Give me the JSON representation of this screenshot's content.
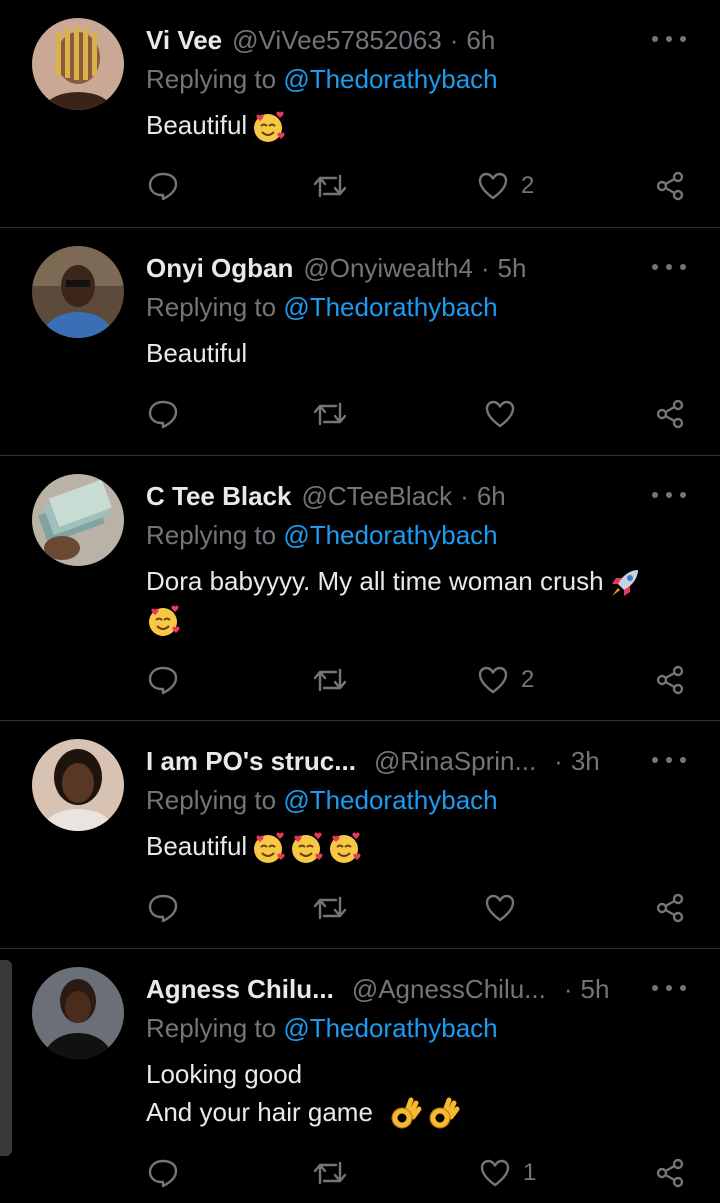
{
  "replying_prefix": "Replying to",
  "colors": {
    "background": "#000000",
    "name": "#e7e9ea",
    "secondary": "#71767b",
    "link": "#1d9bf0",
    "divider": "#2f3336"
  },
  "replies": [
    {
      "name": "Vi Vee",
      "handle": "@ViVee57852063",
      "separator": "·",
      "time": "6h",
      "replying_to": "@Thedorathybach",
      "lines": [
        "Beautiful"
      ],
      "emojis": [
        "smiling-face-with-hearts"
      ],
      "likes": "2"
    },
    {
      "name": "Onyi Ogban",
      "handle": "@Onyiwealth4",
      "separator": "·",
      "time": "5h",
      "replying_to": "@Thedorathybach",
      "lines": [
        "Beautiful"
      ],
      "emojis": [],
      "likes": ""
    },
    {
      "name": "C Tee Black",
      "handle": "@CTeeBlack",
      "separator": "·",
      "time": "6h",
      "replying_to": "@Thedorathybach",
      "lines": [
        "Dora babyyyy. My all time woman crush"
      ],
      "emojis": [
        "rocket",
        "smiling-face-with-hearts"
      ],
      "likes": "2"
    },
    {
      "name": "I am PO's struc...",
      "handle": "@RinaSprin...",
      "separator": "·",
      "time": "3h",
      "replying_to": "@Thedorathybach",
      "lines": [
        "Beautiful"
      ],
      "emojis": [
        "smiling-face-with-hearts",
        "smiling-face-with-hearts",
        "smiling-face-with-hearts"
      ],
      "likes": ""
    },
    {
      "name": "Agness Chilu...",
      "handle": "@AgnessChilu...",
      "separator": "·",
      "time": "5h",
      "replying_to": "@Thedorathybach",
      "lines": [
        "Looking good",
        "And your hair game"
      ],
      "emojis": [
        "ok-hand",
        "ok-hand"
      ],
      "likes": "1"
    }
  ]
}
